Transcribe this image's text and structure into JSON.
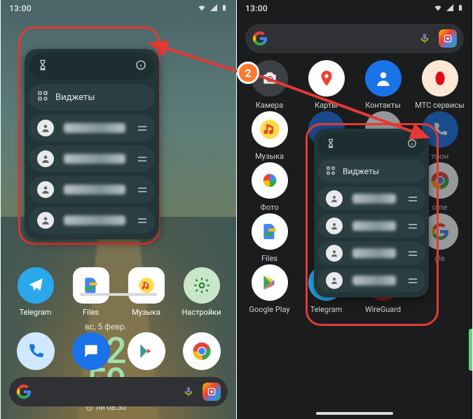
{
  "status": {
    "time": "13:00"
  },
  "popup": {
    "widgets_label": "Виджеты"
  },
  "clock": {
    "date_line": "вс, 5 февр.",
    "time_top": "22",
    "time_bottom": "59",
    "alarm": "пн 08:30"
  },
  "left_home_apps": [
    {
      "label": "Telegram"
    },
    {
      "label": "Files"
    },
    {
      "label": "Музыка"
    },
    {
      "label": "Настройки"
    }
  ],
  "right_apps": {
    "row1": [
      "Камера",
      "Карты",
      "Контакты",
      "МТС сервисы"
    ],
    "row2": [
      "Музыка",
      "",
      "",
      "тфон"
    ],
    "row3": [
      "Фото",
      "",
      "",
      "ome"
    ],
    "row4": [
      "Files",
      "",
      "",
      "gle"
    ],
    "row5": [
      "Google Play",
      "Telegram",
      "WireGuard",
      ""
    ]
  },
  "annotation": {
    "step_number": "2"
  }
}
